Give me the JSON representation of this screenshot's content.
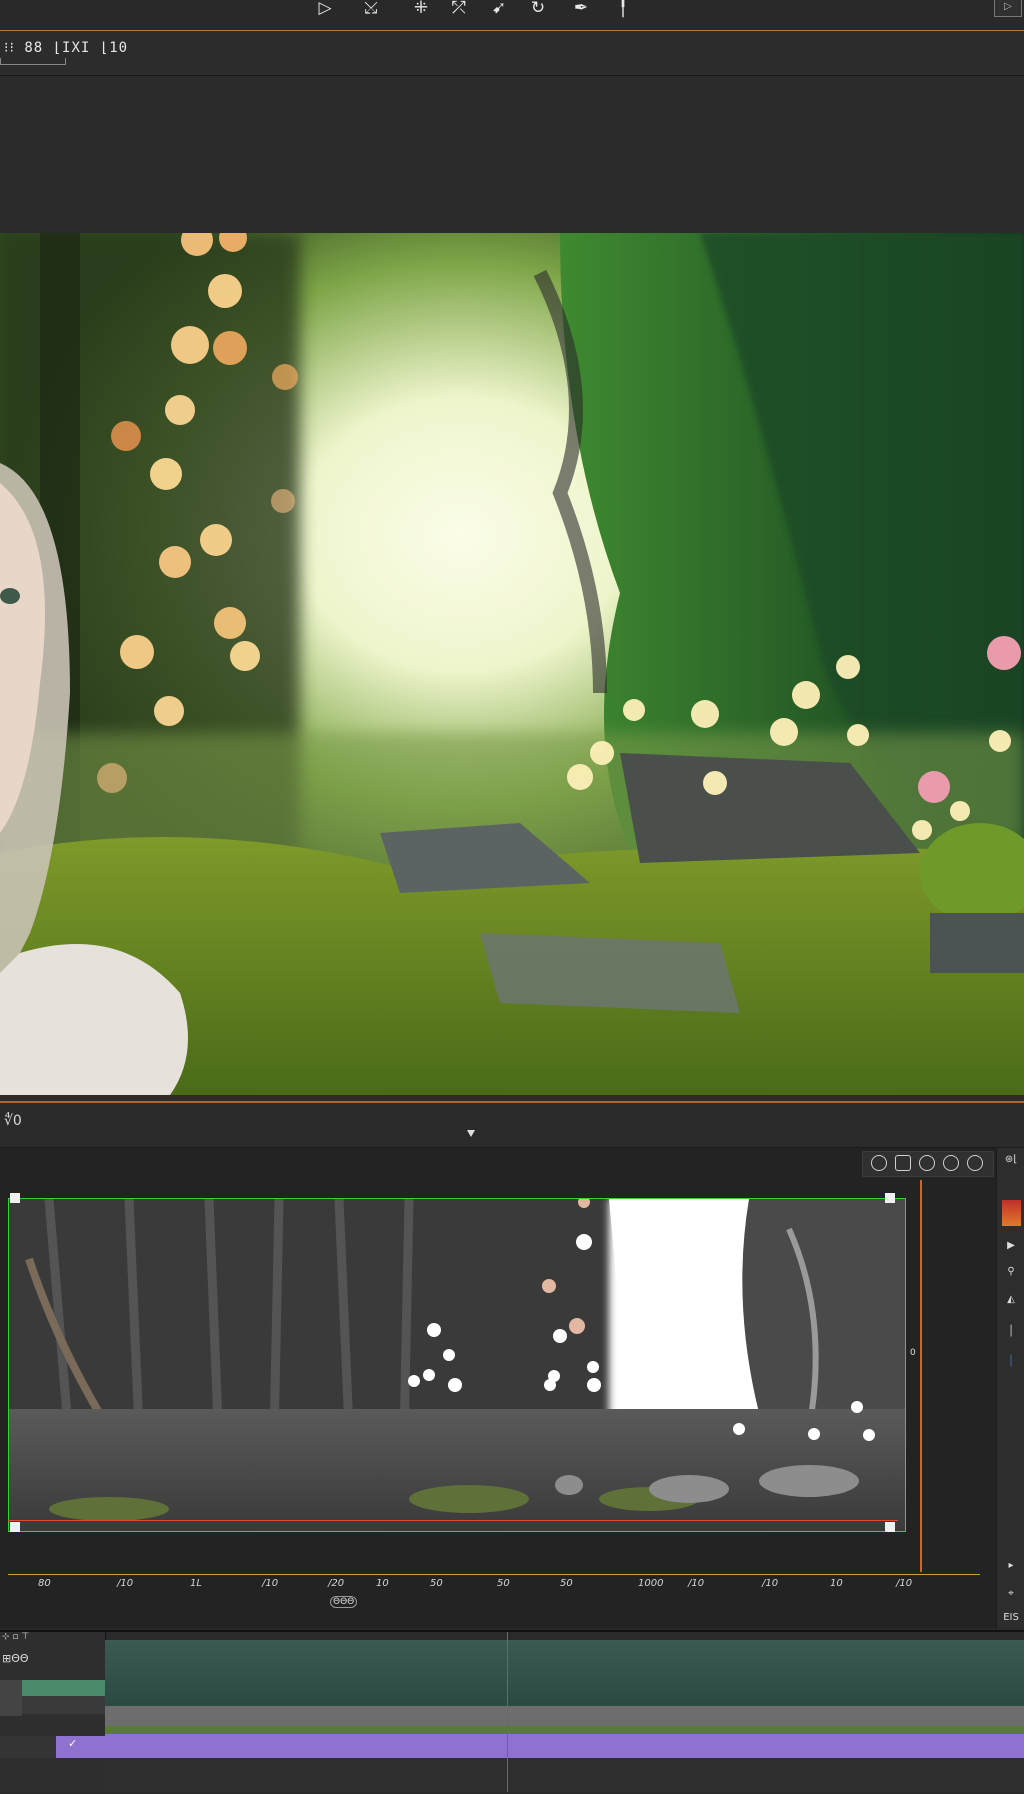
{
  "toolbar": {
    "icons": [
      "play-icon",
      "cursor-icon",
      "select-icon",
      "transform-icon",
      "arrow-icon",
      "rotate-icon",
      "pen-icon",
      "pin-icon"
    ],
    "right_box": "▷"
  },
  "info_bar": {
    "text": "⁝⁝ 88   ⌊IXI ⌊10"
  },
  "preview": {
    "header_label": "∜0",
    "side_marker": "0"
  },
  "ruler": {
    "ticks": [
      "80",
      "/10",
      "1L",
      "/10",
      "/20",
      "10",
      "50",
      "50",
      "50",
      "1000",
      "/10",
      "/10",
      "10",
      "/10"
    ],
    "badge": "ΘΘΘ"
  },
  "right_strip": {
    "top_label": "⊛⌊",
    "items": [
      "▶",
      "⚲",
      "◭",
      "│",
      "│",
      "▸",
      "⌖",
      "EIS"
    ]
  },
  "timeline": {
    "label_a": "⊹ ▫ ⊤",
    "label_b": "⊞ΘΘ",
    "clip_marker": "✓"
  },
  "colors": {
    "accent_orange": "#c8692a",
    "frame_green": "#38d038",
    "ruler_gold": "#c9a237",
    "purple_track": "#8f72cf",
    "green_track": "#4a8a6a",
    "cursor_blue": "#3e6fb8"
  }
}
